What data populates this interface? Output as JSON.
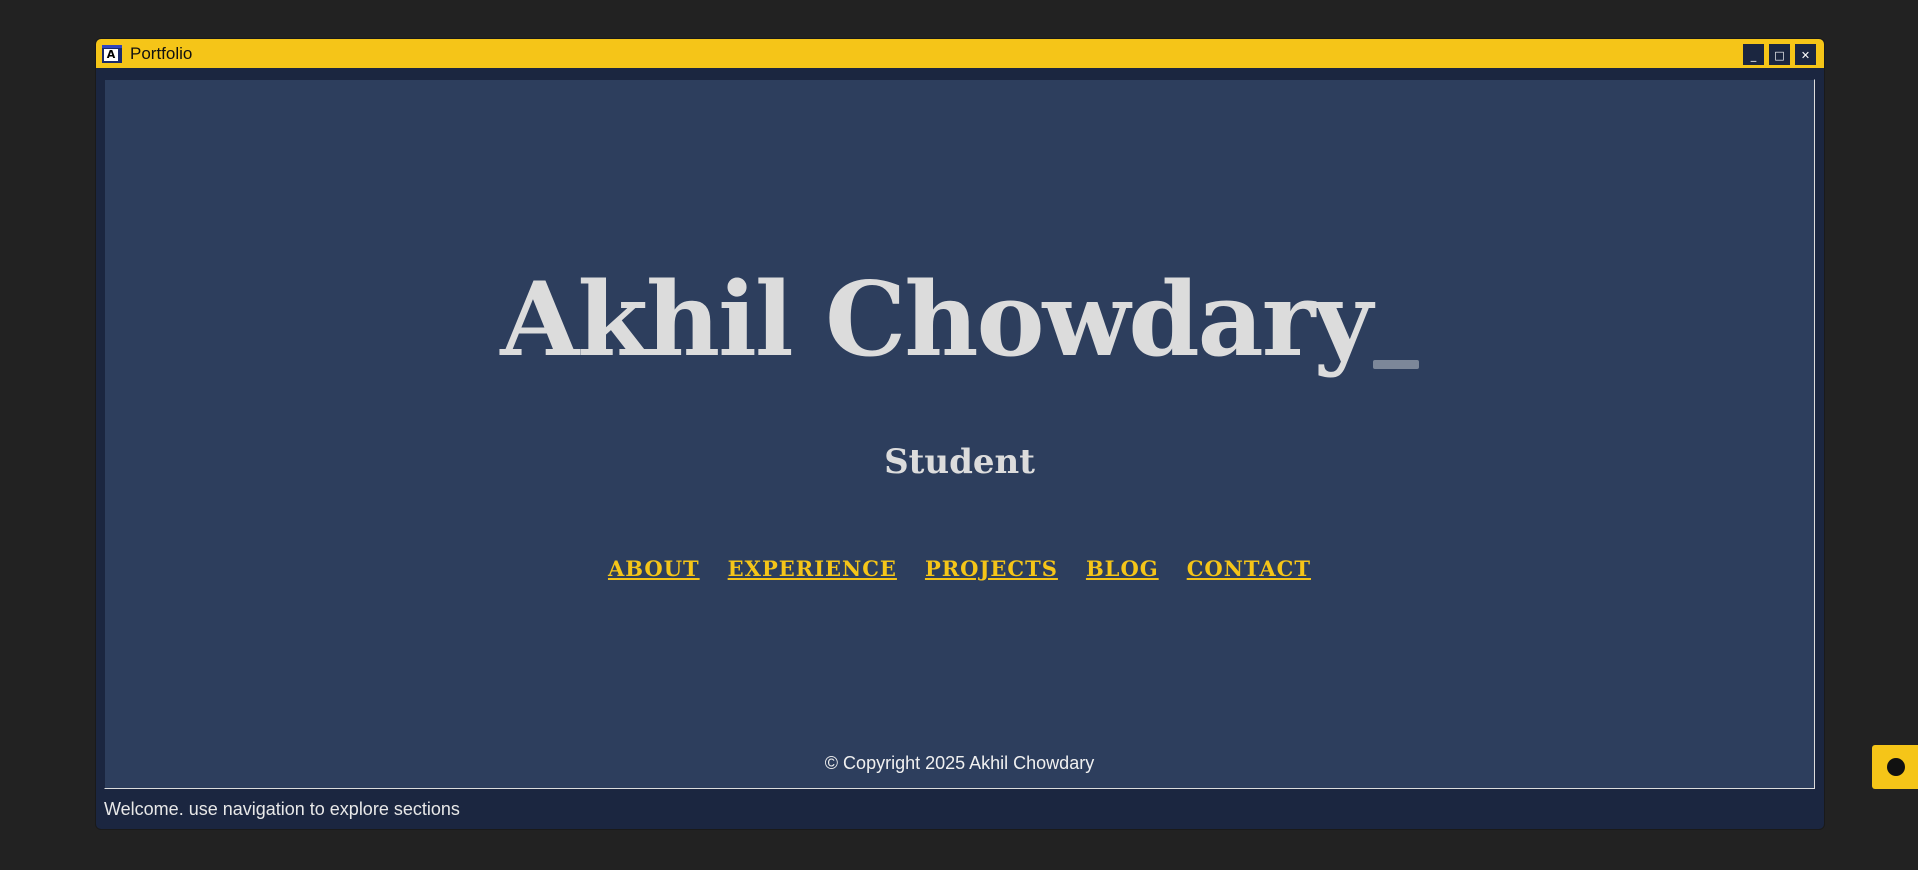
{
  "window": {
    "title": "Portfolio",
    "app_icon_letter": "A",
    "controls": {
      "minimize": "_",
      "maximize": "□",
      "close": "✕"
    }
  },
  "hero": {
    "name": "Akhil Chowdary",
    "role": "Student"
  },
  "nav": {
    "items": [
      "ABOUT",
      "EXPERIENCE",
      "PROJECTS",
      "BLOG",
      "CONTACT"
    ]
  },
  "footer": {
    "copyright": "© Copyright 2025 Akhil Chowdary"
  },
  "status": {
    "text": "Welcome. use navigation to explore sections"
  },
  "colors": {
    "accent": "#f5c518",
    "content_bg": "#2d3e5d",
    "frame_bg": "#1b2640",
    "page_bg": "#222222",
    "text": "#dcdcdc"
  },
  "icons": {
    "fab": "dot-icon",
    "cursor": "text-cursor-icon"
  }
}
